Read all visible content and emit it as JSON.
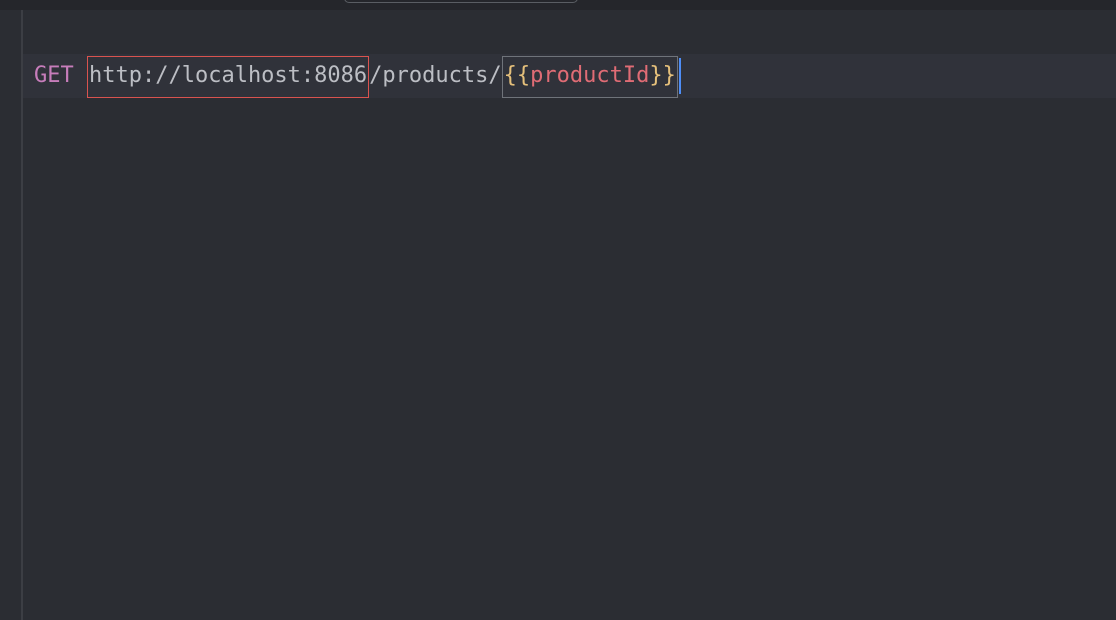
{
  "editor": {
    "lines": {
      "separator": "###",
      "method": "GET",
      "url_host": "http://localhost:8086",
      "url_path": "/products/",
      "var_open": "{{",
      "var_name": "productId",
      "var_close": "}}"
    }
  },
  "colors": {
    "background": "#2b2d33",
    "method": "#c77dbb",
    "brace": "#e5c07b",
    "variable": "#e06c75",
    "highlight_border": "#d9534f",
    "caret": "#4e8ef7"
  }
}
